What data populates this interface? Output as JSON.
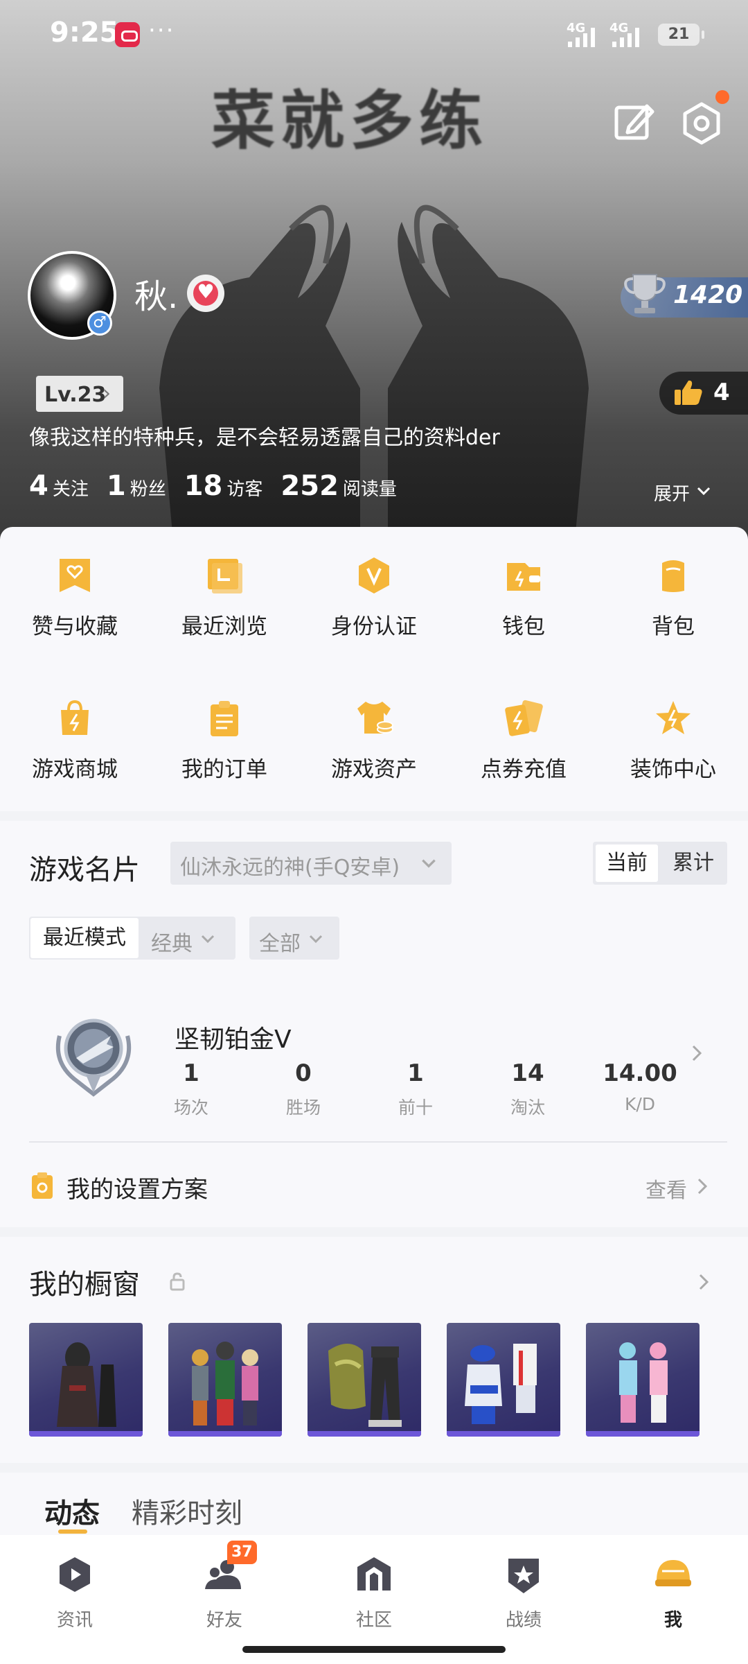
{
  "status_bar": {
    "time": "9:25",
    "dots": "···",
    "signal_1": "4G",
    "signal_2": "4G",
    "battery": "21"
  },
  "hero": {
    "title": "菜就多练",
    "username": "秋.",
    "gender_symbol": "♂",
    "heart_symbol": "♥",
    "trophy_value": "1420",
    "level": "Lv.23",
    "like_count": "4",
    "bio": "像我这样的特种兵，是不会轻易透露自己的资料der",
    "stats": [
      {
        "value": "4",
        "label": "关注"
      },
      {
        "value": "1",
        "label": "粉丝"
      },
      {
        "value": "18",
        "label": "访客"
      },
      {
        "value": "252",
        "label": "阅读量"
      }
    ],
    "expand_label": "展开"
  },
  "menu": {
    "items": [
      {
        "label": "赞与收藏",
        "icon": "bookmark-heart-icon"
      },
      {
        "label": "最近浏览",
        "icon": "recent-folder-icon"
      },
      {
        "label": "身份认证",
        "icon": "verify-v-icon"
      },
      {
        "label": "钱包",
        "icon": "wallet-icon"
      },
      {
        "label": "背包",
        "icon": "backpack-icon"
      },
      {
        "label": "游戏商城",
        "icon": "shopping-bag-icon"
      },
      {
        "label": "我的订单",
        "icon": "order-clipboard-icon"
      },
      {
        "label": "游戏资产",
        "icon": "tshirt-coin-icon"
      },
      {
        "label": "点券充值",
        "icon": "coupon-recharge-icon"
      },
      {
        "label": "装饰中心",
        "icon": "star-decor-icon"
      }
    ],
    "accent_color": "#f5b63a"
  },
  "game_card": {
    "title": "游戏名片",
    "server": "仙沐永远的神(手Q安卓)",
    "toggle_current": "当前",
    "toggle_total": "累计",
    "mode_recent": "最近模式",
    "mode_classic": "经典",
    "filter_all": "全部",
    "rank_name": "坚韧铂金V",
    "stats": [
      {
        "value": "1",
        "label": "场次"
      },
      {
        "value": "0",
        "label": "胜场"
      },
      {
        "value": "1",
        "label": "前十"
      },
      {
        "value": "14",
        "label": "淘汰"
      },
      {
        "value": "14.00",
        "label": "K/D"
      }
    ],
    "setup_label": "我的设置方案",
    "setup_view": "查看"
  },
  "window": {
    "title": "我的橱窗",
    "items": [
      "dark-hooded-outfit",
      "mixed-squad-outfit",
      "camo-cloak-outfit",
      "white-blue-outfit",
      "pink-blue-outfit"
    ]
  },
  "feed_tabs": {
    "active": "动态",
    "other": "精彩时刻"
  },
  "bottom_nav": {
    "items": [
      {
        "label": "资讯",
        "icon": "news-play-icon"
      },
      {
        "label": "好友",
        "icon": "friends-icon"
      },
      {
        "label": "社区",
        "icon": "community-house-icon"
      },
      {
        "label": "战绩",
        "icon": "record-badge-icon"
      },
      {
        "label": "我",
        "icon": "helmet-icon"
      }
    ],
    "friends_badge": "37"
  }
}
